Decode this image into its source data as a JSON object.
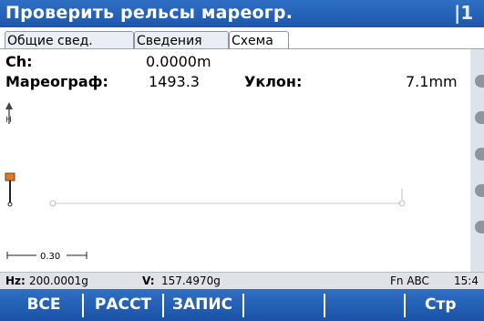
{
  "title": "Проверить рельсы мареогр.",
  "title_right": "|1",
  "tabs": [
    "Общие свед.",
    "Сведения",
    "Схема"
  ],
  "fields": {
    "ch_label": "Ch:",
    "ch_value": "0.0000m",
    "gauge_label": "Мареограф:",
    "gauge_value": "1493.3",
    "slope_label": "Уклон:",
    "slope_value": "7.1mm"
  },
  "diagram": {
    "axis_label": "H",
    "scale_label": "0.30"
  },
  "status": {
    "hz_label": "Hz:",
    "hz_value": "200.0001g",
    "v_label": "V:",
    "v_value": "157.4970g",
    "mode": "Fn ABC",
    "time": "15:4"
  },
  "softkeys": [
    "ВСЕ",
    "РАССТ",
    "ЗАПИС",
    "",
    "",
    "Стр"
  ],
  "colors": {
    "accent": "#1d57ad",
    "marker": "#e07a2a"
  }
}
